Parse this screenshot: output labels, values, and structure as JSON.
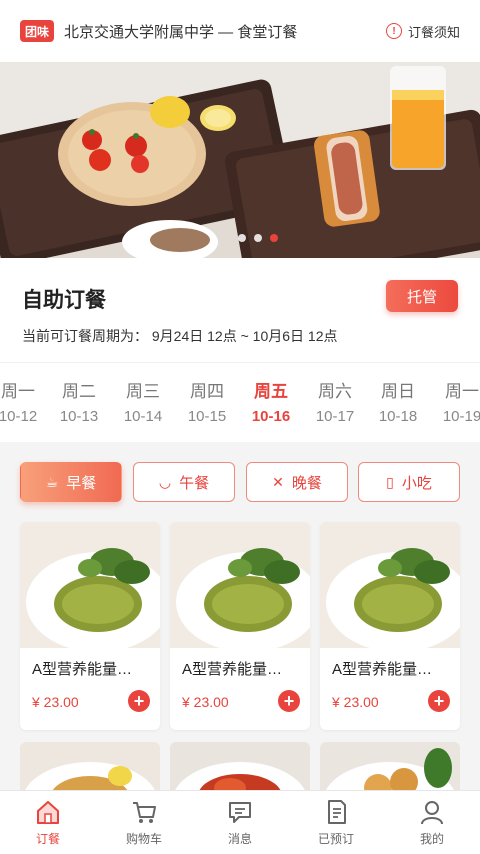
{
  "header": {
    "logo": "团味",
    "title": "北京交通大学附属中学 — 食堂订餐",
    "notice_label": "订餐须知",
    "notice_icon": "info-icon"
  },
  "banner": {
    "slides": 3,
    "active_slide": 3
  },
  "order": {
    "title": "自助订餐",
    "tuoguan_label": "托管",
    "period_text": "当前可订餐周期为： 9月24日 12点 ~ 10月6日 12点"
  },
  "days": [
    {
      "weekday": "周一",
      "date": "10-12"
    },
    {
      "weekday": "周二",
      "date": "10-13"
    },
    {
      "weekday": "周三",
      "date": "10-14"
    },
    {
      "weekday": "周四",
      "date": "10-15"
    },
    {
      "weekday": "周五",
      "date": "10-16",
      "active": true
    },
    {
      "weekday": "周六",
      "date": "10-17"
    },
    {
      "weekday": "周日",
      "date": "10-18"
    },
    {
      "weekday": "周一",
      "date": "10-19"
    }
  ],
  "meals": [
    {
      "label": "早餐",
      "icon": "coffee-icon",
      "active": true
    },
    {
      "label": "午餐",
      "icon": "bowl-icon"
    },
    {
      "label": "晚餐",
      "icon": "utensils-icon"
    },
    {
      "label": "小吃",
      "icon": "drink-icon"
    }
  ],
  "products": [
    {
      "name": "A型营养能量…",
      "price": "¥ 23.00"
    },
    {
      "name": "A型营养能量…",
      "price": "¥ 23.00"
    },
    {
      "name": "A型营养能量…",
      "price": "¥ 23.00"
    }
  ],
  "tabbar": [
    {
      "label": "订餐",
      "icon": "home-icon",
      "active": true
    },
    {
      "label": "购物车",
      "icon": "cart-icon"
    },
    {
      "label": "消息",
      "icon": "message-icon"
    },
    {
      "label": "已预订",
      "icon": "document-icon"
    },
    {
      "label": "我的",
      "icon": "user-icon"
    }
  ],
  "colors": {
    "accent": "#e8443d",
    "background": "#f4f4f4"
  }
}
